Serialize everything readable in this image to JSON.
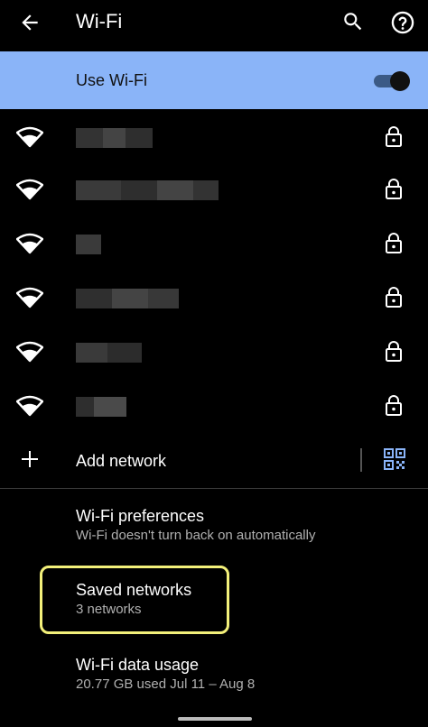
{
  "appbar": {
    "title": "Wi-Fi"
  },
  "use_wifi": {
    "label": "Use Wi-Fi",
    "enabled": true
  },
  "networks": [
    {
      "name": "",
      "locked": true
    },
    {
      "name": "",
      "locked": true
    },
    {
      "name": "",
      "locked": true
    },
    {
      "name": "",
      "locked": true
    },
    {
      "name": "",
      "locked": true
    },
    {
      "name": "",
      "locked": true
    }
  ],
  "add_network": {
    "label": "Add network"
  },
  "preferences": [
    {
      "title": "Wi-Fi preferences",
      "summary": "Wi-Fi doesn't turn back on automatically"
    },
    {
      "title": "Saved networks",
      "summary": "3 networks"
    },
    {
      "title": "Wi-Fi data usage",
      "summary": "20.77 GB used Jul 11 – Aug 8"
    }
  ],
  "colors": {
    "accent": "#8ab4f8",
    "highlight": "#f3f07a",
    "background": "#000000"
  },
  "icons": [
    "back-arrow-icon",
    "search-icon",
    "help-icon",
    "wifi-icon",
    "lock-icon",
    "plus-icon",
    "qr-code-icon"
  ]
}
